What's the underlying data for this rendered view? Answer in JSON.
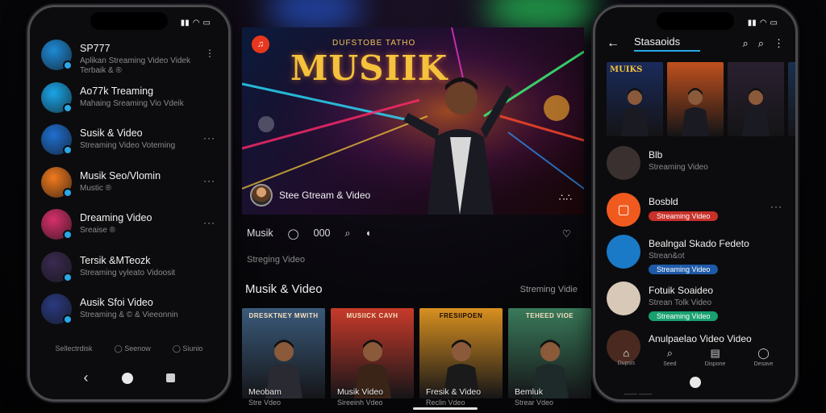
{
  "left_phone": {
    "status": {
      "time": "",
      "icons": [
        "signal-icon",
        "wifi-icon",
        "battery-icon"
      ]
    },
    "chats": [
      {
        "title": "SP777",
        "subtitle": "Aplikan Streaming Video Videk",
        "subtitle2": "Terbaik & ®",
        "color": "#1e8ad6",
        "more": true
      },
      {
        "title": "Ao77k Treaming",
        "subtitle": "Mahaing Sreaming Vio Vdeik",
        "color": "#1aa6e8",
        "more": false
      },
      {
        "title": "Susik & Video",
        "subtitle": "Streaming Video Voteming",
        "color": "#1f6fd0",
        "more": true
      },
      {
        "title": "Musik Seo/Vlomin",
        "subtitle": "Mustic ®",
        "color": "#f07a1e",
        "more": true
      },
      {
        "title": "Dreaming Video",
        "subtitle": "Sreaise ®",
        "color": "#d6306a",
        "more": true
      },
      {
        "title": "Tersik &MTeozk",
        "subtitle": "Streaming vyleato Vidoosit",
        "color": "#3a2a50",
        "more": false
      },
      {
        "title": "Ausik Sfoi Video",
        "subtitle": "Streaming & © & Vieeonnin",
        "color": "#2a3a80",
        "more": false
      }
    ],
    "bottom_labels": [
      "Sellectrdisk",
      "Seenow",
      "Siunio"
    ]
  },
  "center": {
    "hero": {
      "brand_badge": "♫",
      "tagline": "DUFSTOBE TATHO",
      "title": "MUSIIK",
      "footer_text": "Stee Gtream & Video",
      "dots": "∴∴"
    },
    "actions": {
      "label": "Musik",
      "count": "000"
    },
    "sub_label": "Streging Video",
    "section_title": "Musik & Video",
    "section_link": "Streming Vidie",
    "cards": [
      {
        "caption": "DRESKTNEY MWITH",
        "title": "Meobam",
        "subtitle": "Stre Vdeo",
        "bg": "#3a5a7a"
      },
      {
        "caption": "MUSIICK CAVH",
        "title": "Musik Video",
        "subtitle": "Sireeinh Vdeo",
        "bg": "#c83a2a"
      },
      {
        "caption": "FRESIIPOEN",
        "title": "Fresik & Video",
        "subtitle": "Reclin Vdeo",
        "bg": "#d89020"
      },
      {
        "caption": "TEHEED VIOE",
        "title": "Bemluk",
        "subtitle": "Strear Vdeo",
        "bg": "#3a7a5a"
      }
    ]
  },
  "right_phone": {
    "header": {
      "title": "Stasaoids"
    },
    "thumbs": [
      {
        "caption": "MUIKS",
        "bg": "#1a2a5a"
      },
      {
        "caption": "",
        "bg": "#c0501e"
      },
      {
        "caption": "",
        "bg": "#2a2030"
      },
      {
        "caption": "",
        "bg": "#1a3050"
      }
    ],
    "items": [
      {
        "title": "Blb",
        "subtitle": "Streaming Video",
        "pill": "",
        "pill_color": "",
        "color": "#3a3030"
      },
      {
        "title": "Bosbld",
        "subtitle": "",
        "pill": "Streaming Video",
        "pill_color": "#c8302a",
        "color": "#f05a1e",
        "more": true
      },
      {
        "title": "Bealngal Skado Fedeto",
        "subtitle": "Strean&ot",
        "pill": "Streaming Video",
        "pill_color": "#1e5aa8",
        "color": "#1a7ac8"
      },
      {
        "title": "Fotuik Soaideo",
        "subtitle": "Strean Tolk Video",
        "pill": "Streaming Video",
        "pill_color": "#18a070",
        "color": "#d8c8b8"
      },
      {
        "title": "Anulpaelao Video Video",
        "subtitle": "",
        "pill": "",
        "pill_color": "",
        "color": "#4a2a20"
      }
    ],
    "tabs": [
      {
        "label": "Dupsis",
        "icon": "home-icon"
      },
      {
        "label": "Seed",
        "icon": "search-icon"
      },
      {
        "label": "Dispone",
        "icon": "library-icon"
      },
      {
        "label": "Desave",
        "icon": "profile-icon"
      }
    ],
    "bottom_text": "—— ——"
  }
}
